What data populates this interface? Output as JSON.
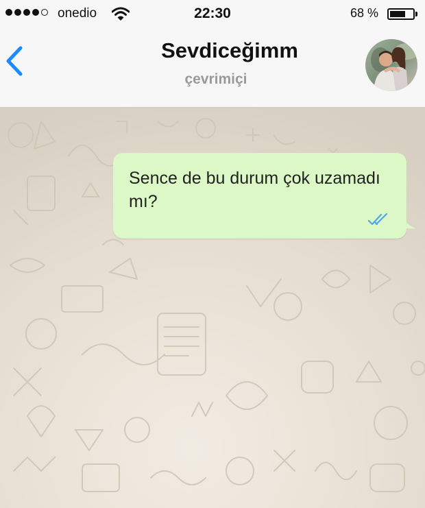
{
  "status_bar": {
    "signal_dots_filled": 4,
    "signal_dots_total": 5,
    "carrier": "onedio",
    "wifi_icon": "wifi-icon",
    "time": "22:30",
    "battery_percent": "68 %",
    "battery_level": 0.68
  },
  "header": {
    "back_icon": "chevron-left-icon",
    "contact_name": "Sevdiceğimm",
    "presence": "çevrimiçi",
    "avatar": "contact-avatar-photo"
  },
  "conversation": {
    "messages": [
      {
        "direction": "outgoing",
        "text": "Sence de bu durum çok uzamadı mı?",
        "status_icon": "double-check-icon",
        "status": "read"
      }
    ]
  },
  "colors": {
    "accent": "#1a8cff",
    "outgoing_bubble": "#dcf8c6",
    "chat_background": "#e6dfd3",
    "read_ticks": "#4fa8e0",
    "bar_background": "#f7f7f7",
    "presence_text": "#9a9a9a"
  }
}
